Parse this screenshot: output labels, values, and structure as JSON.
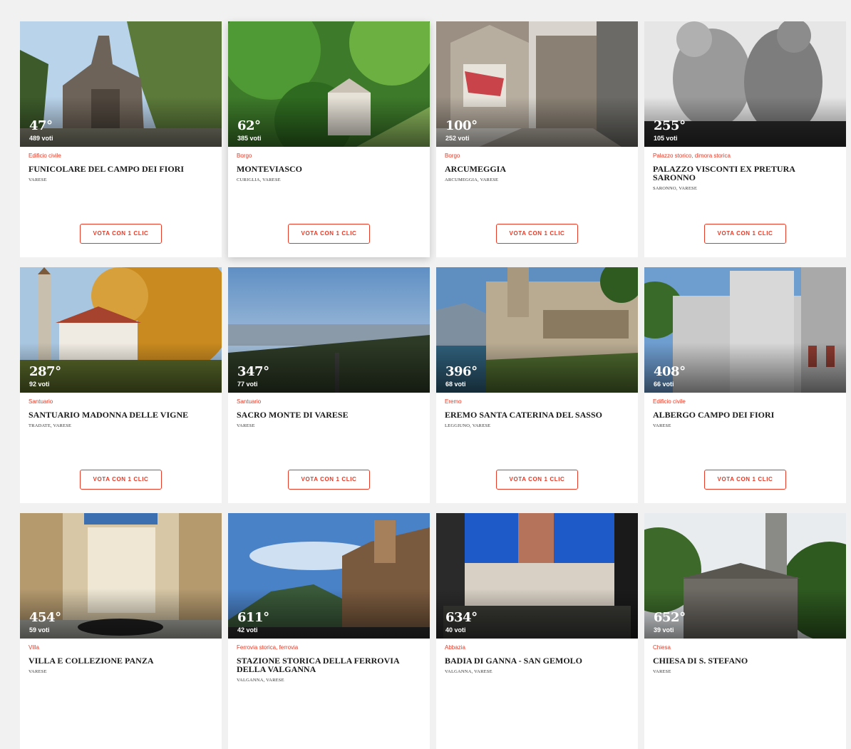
{
  "vote_label": "VOTA CON 1 CLIC",
  "cards": [
    {
      "rank": "47°",
      "votes": "489 voti",
      "category": "Edificio civile",
      "title": "FUNICOLARE DEL CAMPO DEI FIORI",
      "location": "VARESE"
    },
    {
      "rank": "62°",
      "votes": "385 voti",
      "category": "Borgo",
      "title": "MONTEVIASCO",
      "location": "CURIGLIA, VARESE"
    },
    {
      "rank": "100°",
      "votes": "252 voti",
      "category": "Borgo",
      "title": "ARCUMEGGIA",
      "location": "ARCUMEGGIA, VARESE"
    },
    {
      "rank": "255°",
      "votes": "105 voti",
      "category": "Palazzo storico, dimora storica",
      "title": "PALAZZO VISCONTI EX PRETURA SARONNO",
      "location": "SARONNO, VARESE"
    },
    {
      "rank": "287°",
      "votes": "92 voti",
      "category": "Santuario",
      "title": "SANTUARIO MADONNA DELLE VIGNE",
      "location": "TRADATE, VARESE"
    },
    {
      "rank": "347°",
      "votes": "77 voti",
      "category": "Santuario",
      "title": "SACRO MONTE DI VARESE",
      "location": "VARESE"
    },
    {
      "rank": "396°",
      "votes": "68 voti",
      "category": "Eremo",
      "title": "EREMO SANTA CATERINA DEL SASSO",
      "location": "LEGGIUNO, VARESE"
    },
    {
      "rank": "408°",
      "votes": "66 voti",
      "category": "Edificio civile",
      "title": "ALBERGO CAMPO DEI FIORI",
      "location": "VARESE"
    },
    {
      "rank": "454°",
      "votes": "59 voti",
      "category": "Villa",
      "title": "VILLA E COLLEZIONE PANZA",
      "location": "VARESE"
    },
    {
      "rank": "611°",
      "votes": "42 voti",
      "category": "Ferrovia storica, ferrovia",
      "title": "STAZIONE STORICA DELLA FERROVIA DELLA VALGANNA",
      "location": "VALGANNA, VARESE"
    },
    {
      "rank": "634°",
      "votes": "40 voti",
      "category": "Abbazia",
      "title": "BADIA DI GANNA - SAN GEMOLO",
      "location": "VALGANNA, VARESE"
    },
    {
      "rank": "652°",
      "votes": "39 voti",
      "category": "Chiesa",
      "title": "CHIESA DI S. STEFANO",
      "location": "VARESE"
    }
  ]
}
